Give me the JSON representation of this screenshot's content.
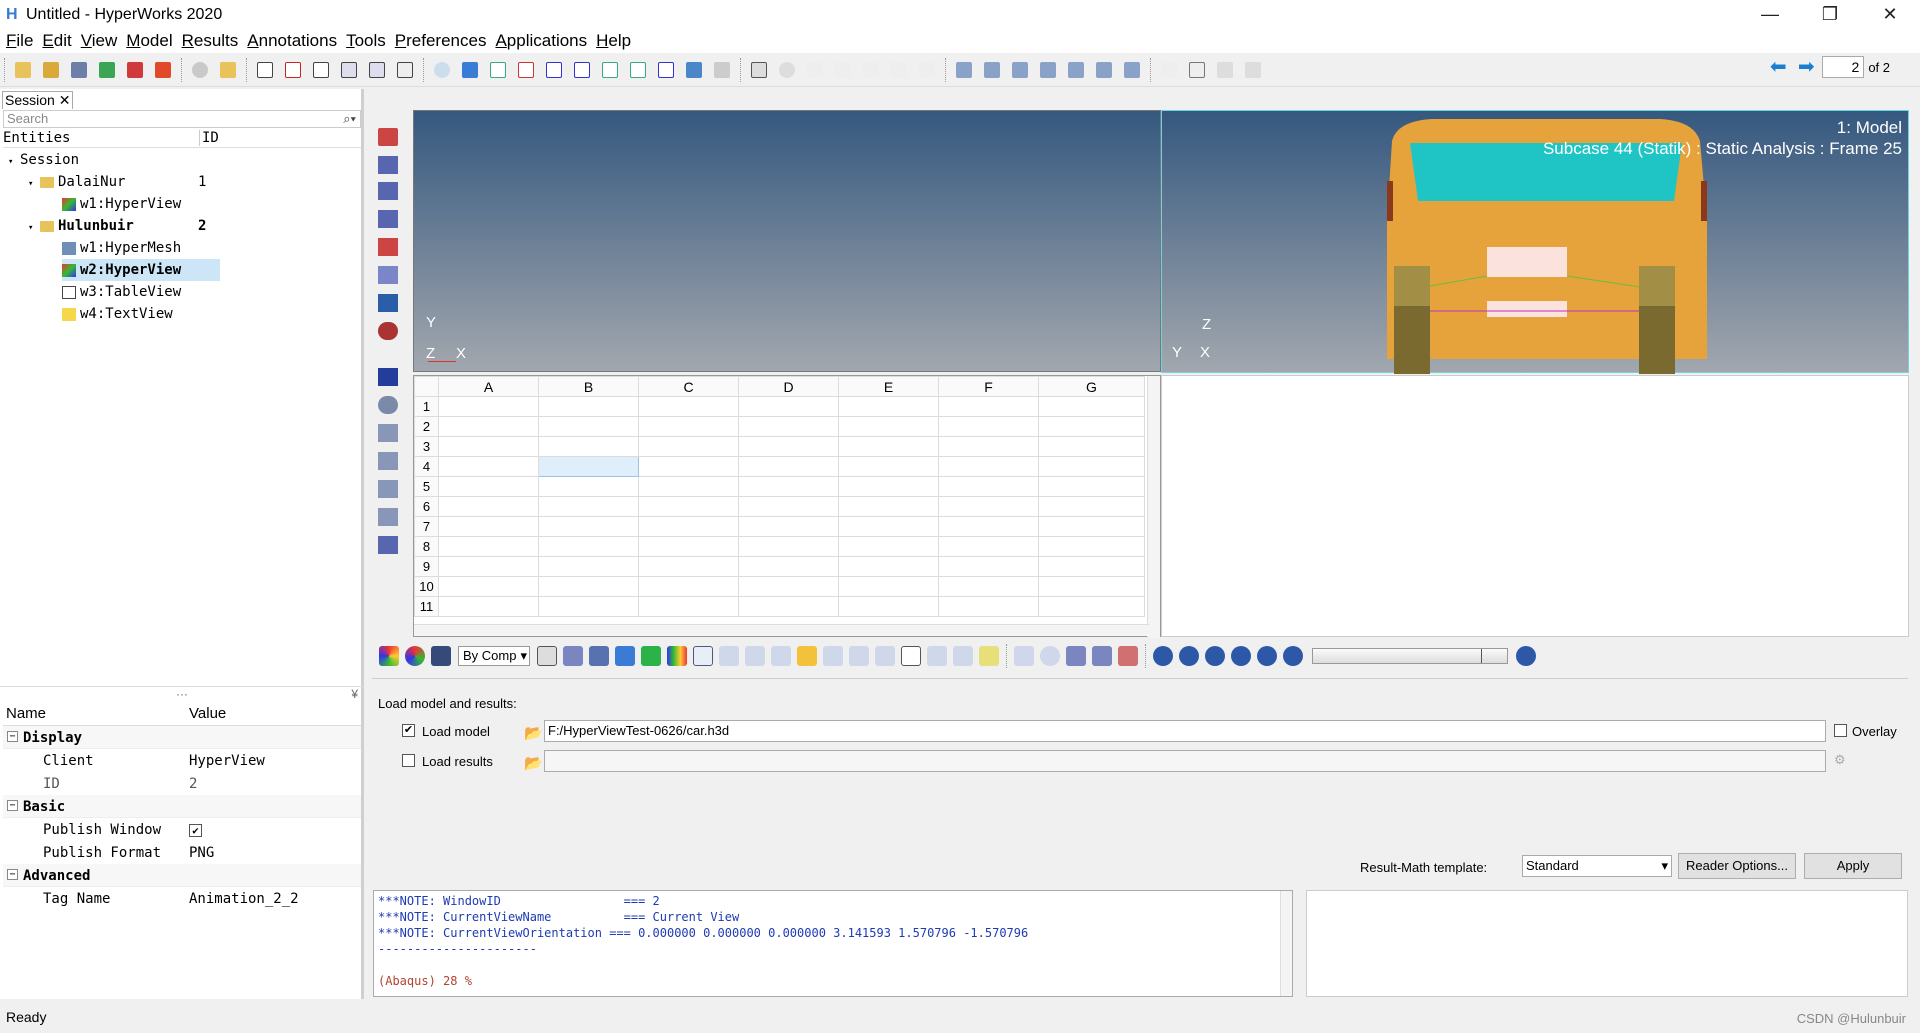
{
  "window": {
    "title": "Untitled - HyperWorks 2020",
    "minimize": "—",
    "restore": "❐",
    "close": "✕"
  },
  "menu": [
    "File",
    "Edit",
    "View",
    "Model",
    "Results",
    "Annotations",
    "Tools",
    "Preferences",
    "Applications",
    "Help"
  ],
  "pagenav": {
    "current": "2",
    "of": "of 2"
  },
  "browser": {
    "tab": "Session",
    "search_placeholder": "Search",
    "col_entities": "Entities",
    "col_id": "ID",
    "tree": [
      {
        "label": "Session",
        "id": ""
      },
      {
        "label": "DalaiNur",
        "id": "1"
      },
      {
        "label": "w1:HyperView",
        "id": ""
      },
      {
        "label": "Hulunbuir",
        "id": "2"
      },
      {
        "label": "w1:HyperMesh",
        "id": ""
      },
      {
        "label": "w2:HyperView",
        "id": ""
      },
      {
        "label": "w3:TableView",
        "id": ""
      },
      {
        "label": "w4:TextView",
        "id": ""
      }
    ]
  },
  "properties": {
    "col_name": "Name",
    "col_value": "Value",
    "display": {
      "title": "Display",
      "client_key": "Client",
      "client_val": "HyperView",
      "id_key": "ID",
      "id_val": "2"
    },
    "basic": {
      "title": "Basic",
      "publish_key": "Publish Window",
      "publish_checked": true,
      "format_key": "Publish Format",
      "format_val": "PNG"
    },
    "advanced": {
      "title": "Advanced",
      "tag_key": "Tag Name",
      "tag_val": "Animation_2_2"
    }
  },
  "viewport1": {
    "y": "Y",
    "z": "Z",
    "x": "X"
  },
  "viewport2": {
    "line1": "1: Model",
    "line2": "Subcase 44 (Statik) : Static Analysis : Frame 25",
    "z": "Z",
    "y": "Y",
    "x": "X"
  },
  "sheet": {
    "cols": [
      "A",
      "B",
      "C",
      "D",
      "E",
      "F",
      "G"
    ],
    "rows": [
      "1",
      "2",
      "3",
      "4",
      "5",
      "6",
      "7",
      "8",
      "9",
      "10",
      "11"
    ],
    "selected_cell": "B4"
  },
  "animbar": {
    "bycomp": "By Comp"
  },
  "load": {
    "heading": "Load model and results:",
    "model_label": "Load model",
    "model_checked": true,
    "model_path": "F:/HyperViewTest-0626/car.h3d",
    "results_label": "Load results",
    "results_checked": false,
    "results_path": "",
    "overlay_label": "Overlay",
    "template_label": "Result-Math template:",
    "template_value": "Standard",
    "reader_btn": "Reader Options...",
    "apply_btn": "Apply"
  },
  "console": {
    "lines": [
      "***NOTE: WindowID                 === 2",
      "***NOTE: CurrentViewName          === Current View",
      "***NOTE: CurrentViewOrientation === 0.000000 0.000000 0.000000 3.141593 1.570796 -1.570796",
      "----------------------"
    ],
    "progress": "(Abaqus) 28 %"
  },
  "status": {
    "left": "Ready",
    "right": "CSDN @Hulunbuir"
  },
  "colors": {
    "accent": "#1a7fd0",
    "viewport_top": "#35587f",
    "viewport_bottom": "#a2a7ae",
    "car_body": "#e6a33c",
    "car_glass": "#1fc4c4"
  }
}
